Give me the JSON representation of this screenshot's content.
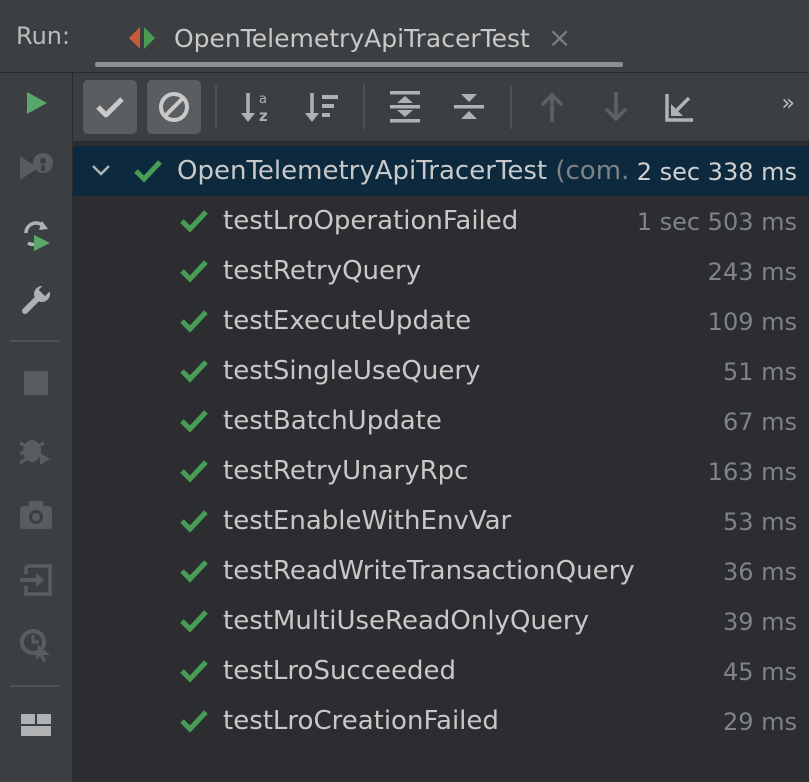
{
  "header": {
    "run_label": "Run:",
    "tab_title": "OpenTelemetryApiTracerTest",
    "tab_close": "×"
  },
  "left_toolbar": {
    "icons": [
      "run-icon",
      "rerun-failed-icon",
      "toggle-auto-test-icon",
      "settings-wrench-icon",
      "stop-icon",
      "debug-icon",
      "screenshot-camera-icon",
      "import-tests-icon",
      "coverage-icon",
      "layout-icon"
    ]
  },
  "toolbar": {
    "icons": [
      "show-passed-icon",
      "show-ignored-icon",
      "sort-alphabetically-icon",
      "sort-by-duration-icon",
      "expand-all-icon",
      "collapse-all-icon",
      "previous-failed-icon",
      "next-failed-icon",
      "export-results-icon"
    ],
    "more": "»"
  },
  "colors": {
    "accent_green": "#499c54",
    "run_green": "#59a869",
    "selection": "#0d293e"
  },
  "tree": {
    "root": {
      "name": "OpenTelemetryApiTracerTest",
      "pkg": "(com.",
      "duration": "2 sec 338 ms"
    },
    "tests": [
      {
        "name": "testLroOperationFailed",
        "duration": "1 sec 503 ms"
      },
      {
        "name": "testRetryQuery",
        "duration": "243 ms"
      },
      {
        "name": "testExecuteUpdate",
        "duration": "109 ms"
      },
      {
        "name": "testSingleUseQuery",
        "duration": "51 ms"
      },
      {
        "name": "testBatchUpdate",
        "duration": "67 ms"
      },
      {
        "name": "testRetryUnaryRpc",
        "duration": "163 ms"
      },
      {
        "name": "testEnableWithEnvVar",
        "duration": "53 ms"
      },
      {
        "name": "testReadWriteTransactionQuery",
        "duration": "36 ms"
      },
      {
        "name": "testMultiUseReadOnlyQuery",
        "duration": "39 ms"
      },
      {
        "name": "testLroSucceeded",
        "duration": "45 ms"
      },
      {
        "name": "testLroCreationFailed",
        "duration": "29 ms"
      }
    ]
  }
}
